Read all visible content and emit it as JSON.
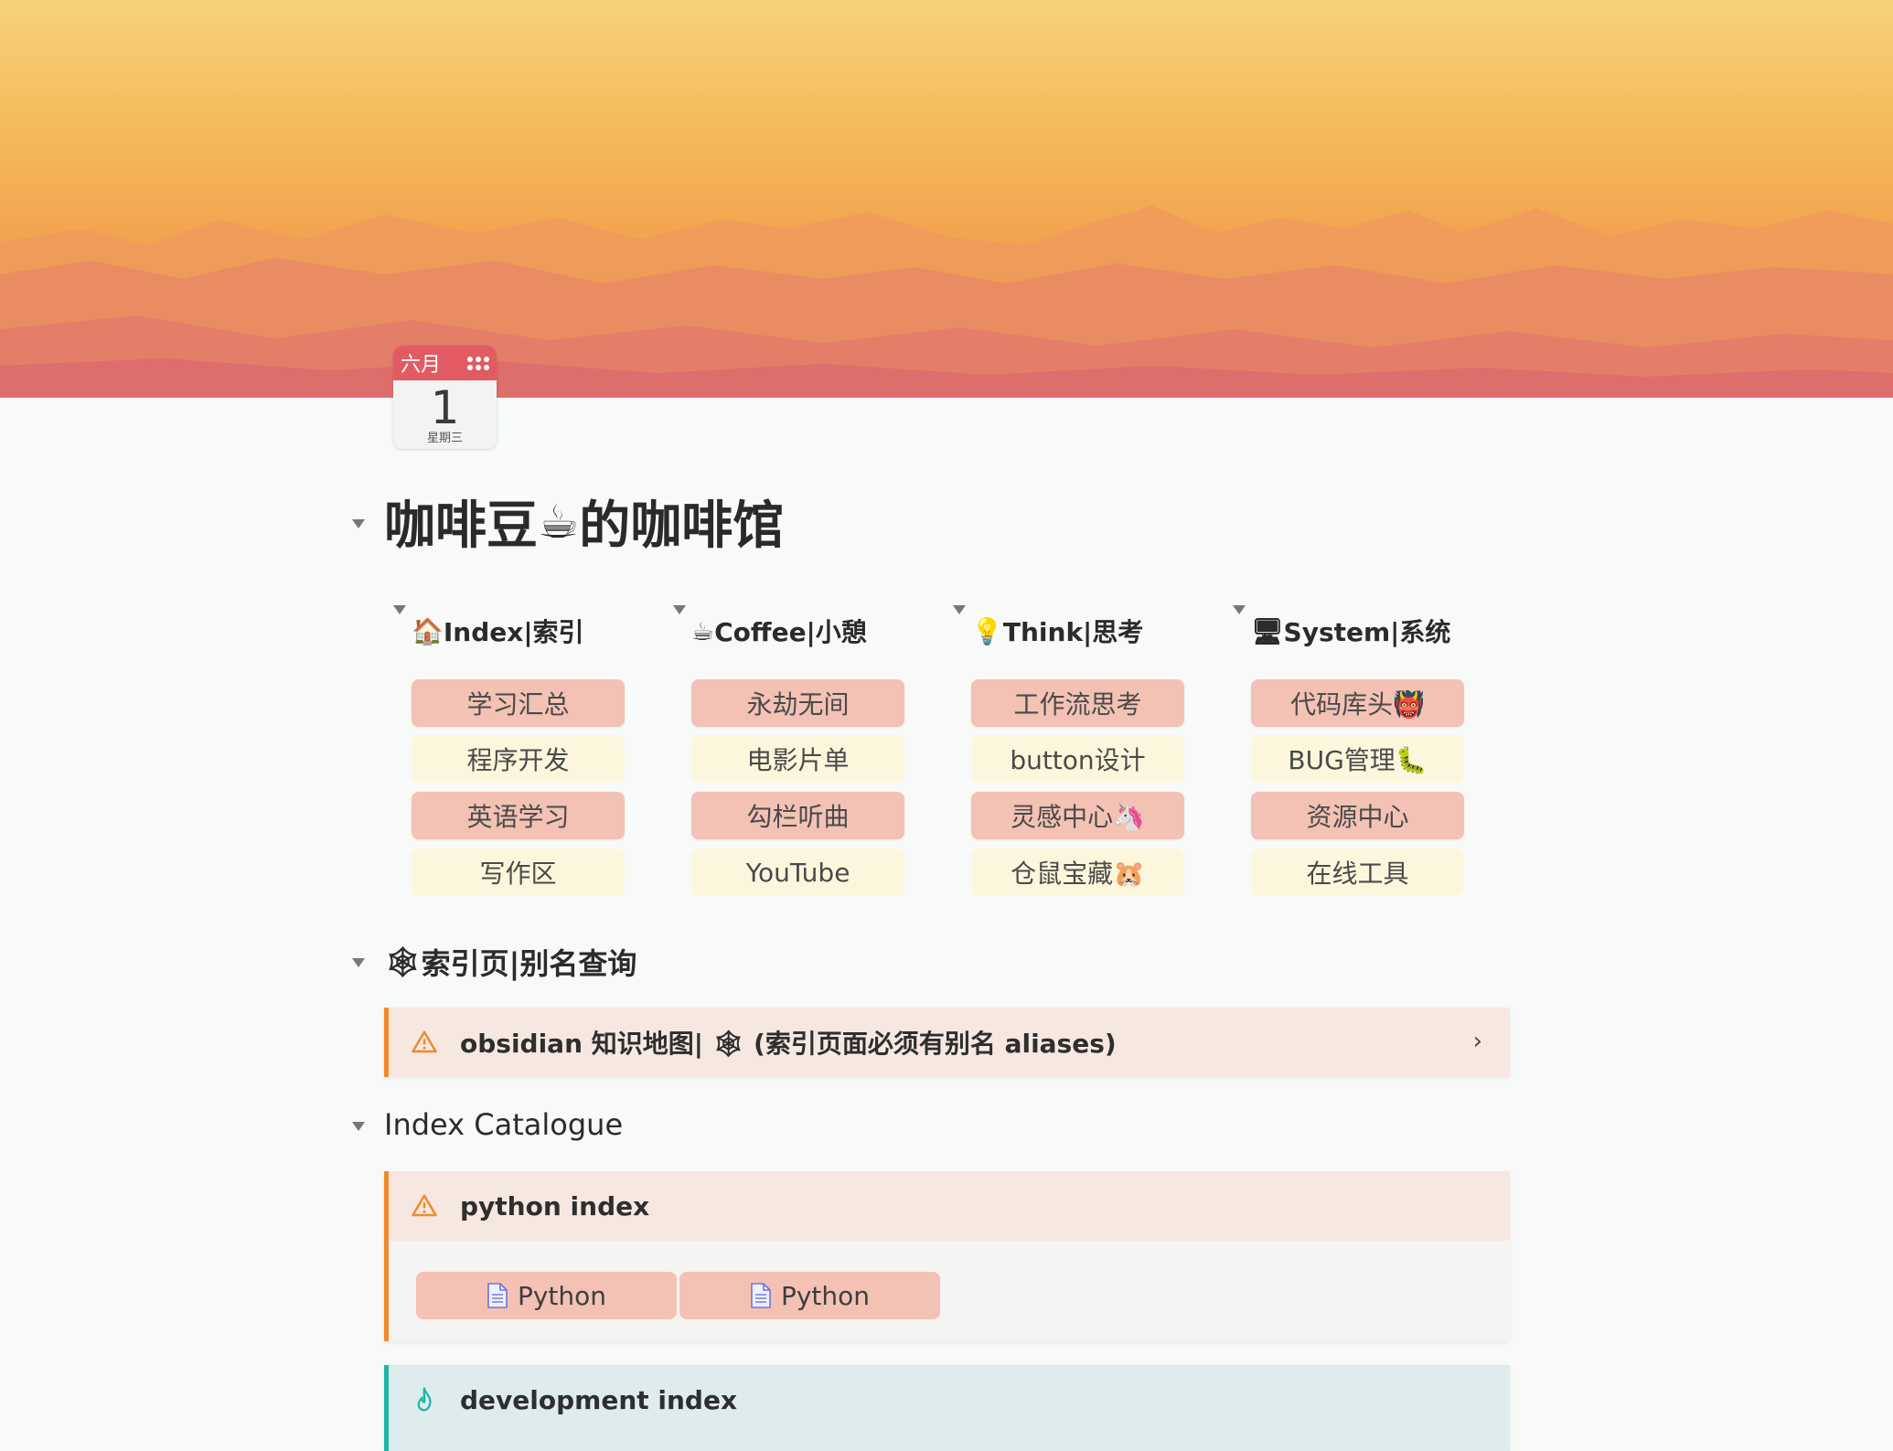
{
  "calendar": {
    "month": "六月",
    "day": "1",
    "weekday": "星期三"
  },
  "title": {
    "text_a": "咖啡豆",
    "emoji": "☕",
    "text_b": "的咖啡馆"
  },
  "columns": [
    {
      "icon": "🏠",
      "label": "Index|索引",
      "buttons": [
        {
          "label": "学习汇总",
          "style": "pink"
        },
        {
          "label": "程序开发",
          "style": "cream"
        },
        {
          "label": "英语学习",
          "style": "pink"
        },
        {
          "label": "写作区",
          "style": "cream"
        }
      ]
    },
    {
      "icon": "☕",
      "label": "Coffee|小憩",
      "buttons": [
        {
          "label": "永劫无间",
          "style": "pink"
        },
        {
          "label": "电影片单",
          "style": "cream"
        },
        {
          "label": "勾栏听曲",
          "style": "pink"
        },
        {
          "label": "YouTube",
          "style": "cream"
        }
      ]
    },
    {
      "icon": "💡",
      "label": "Think|思考",
      "buttons": [
        {
          "label": "工作流思考",
          "style": "pink"
        },
        {
          "label": "button设计",
          "style": "cream"
        },
        {
          "label": "灵感中心🦄",
          "style": "pink"
        },
        {
          "label": "仓鼠宝藏🐹",
          "style": "cream"
        }
      ]
    },
    {
      "icon": "🖥",
      "label": "System|系统",
      "buttons": [
        {
          "label": "代码库头👹",
          "style": "pink"
        },
        {
          "label": "BUG管理🐛",
          "style": "cream"
        },
        {
          "label": "资源中心",
          "style": "pink"
        },
        {
          "label": "在线工具",
          "style": "cream"
        }
      ]
    }
  ],
  "section_alias": {
    "icon": "🕸",
    "label": "索引页|别名查询"
  },
  "callout_alias": {
    "label": "obsidian 知识地图| 🕸 (索引页面必须有别名 aliases)",
    "chevron": "›"
  },
  "section_catalogue": {
    "label": "Index Catalogue"
  },
  "callout_python": {
    "label": "python index",
    "files": [
      "Python",
      "Python"
    ]
  },
  "callout_dev": {
    "label": "development index"
  },
  "colors": {
    "pink_button": "#f3c2b4",
    "cream_button": "#fcf7dc",
    "warning_accent": "#f08a2b",
    "teal_accent": "#1fb5a6"
  }
}
